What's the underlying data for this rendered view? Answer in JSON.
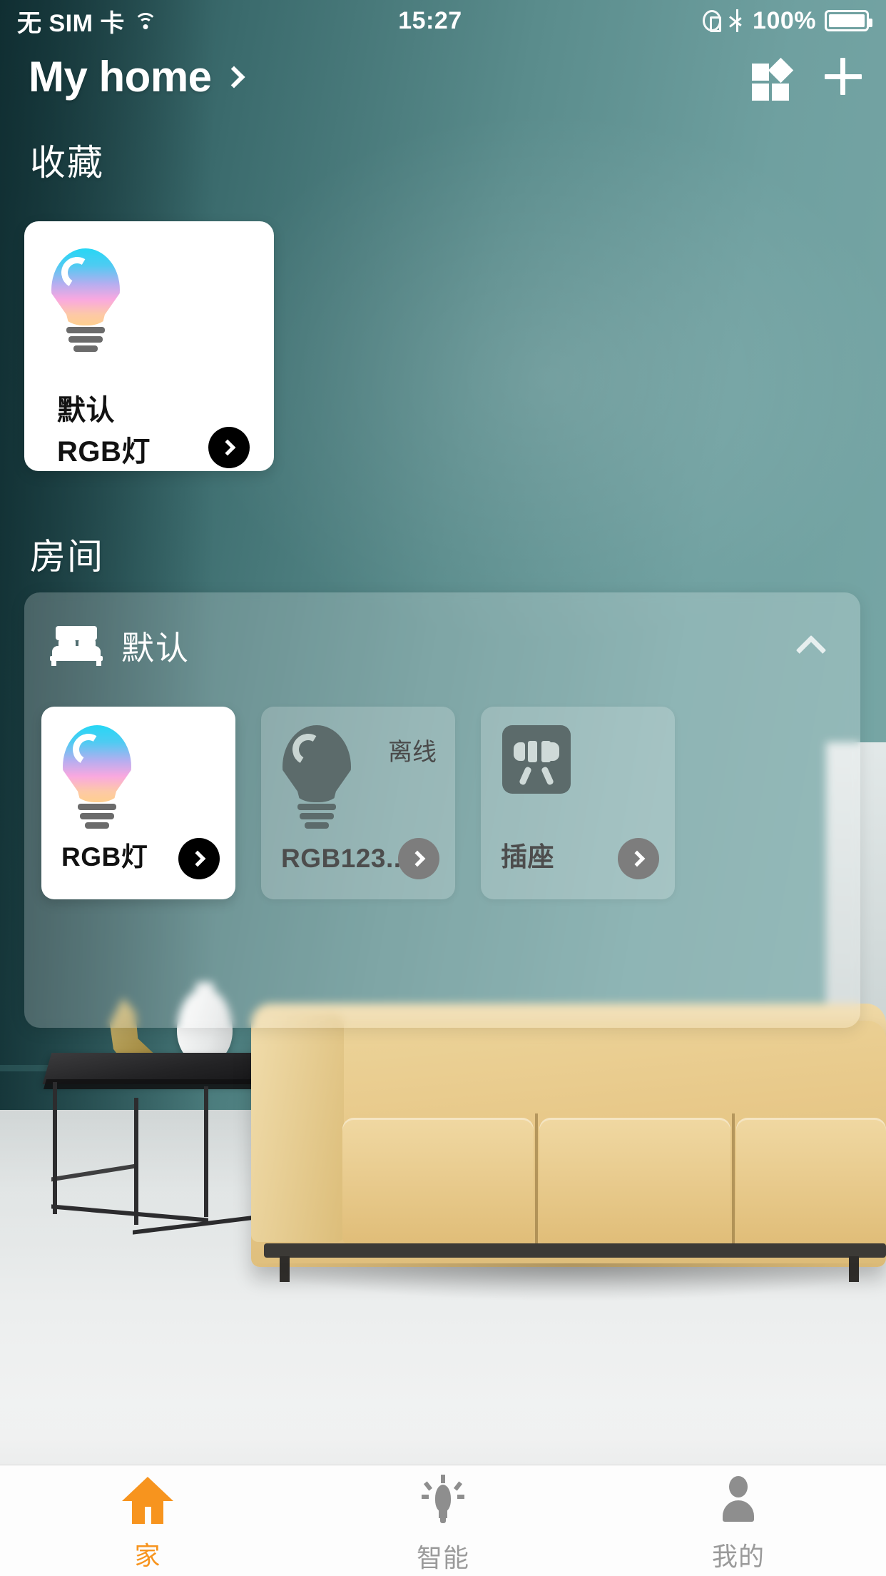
{
  "status_bar": {
    "carrier": "无 SIM 卡",
    "wifi_icon": "wifi-icon",
    "time": "15:27",
    "rotation_lock_icon": "rotation-lock-icon",
    "bluetooth_icon": "bluetooth-icon",
    "battery_percent": "100%",
    "battery_icon": "battery-full-icon"
  },
  "header": {
    "title": "My home",
    "title_chevron_icon": "chevron-right-icon",
    "scene_icon": "scene-grid-icon",
    "add_icon": "plus-icon"
  },
  "favorites": {
    "section_title": "收藏",
    "card": {
      "device_icon": "rgb-bulb-icon",
      "room_name": "默认",
      "device_name": "RGB灯",
      "arrow_icon": "chevron-right-circle-icon",
      "arrow_color": "#000000"
    }
  },
  "rooms": {
    "section_title": "房间",
    "list": [
      {
        "room_icon": "bed-icon",
        "name": "默认",
        "collapse_icon": "chevron-up-icon",
        "devices": [
          {
            "icon": "rgb-bulb-icon",
            "name": "RGB灯",
            "status": "",
            "state": "online",
            "arrow_icon": "chevron-right-circle-icon",
            "arrow_color": "#000000"
          },
          {
            "icon": "bulb-off-icon",
            "name": "RGB123...",
            "status": "离线",
            "state": "offline",
            "arrow_icon": "chevron-right-circle-icon",
            "arrow_color": "#7d7d7d"
          },
          {
            "icon": "socket-icon",
            "name": "插座",
            "status": "",
            "state": "offline",
            "arrow_icon": "chevron-right-circle-icon",
            "arrow_color": "#7d7d7d"
          }
        ]
      }
    ]
  },
  "tabbar": {
    "items": [
      {
        "icon": "house-icon",
        "label": "家",
        "active": true
      },
      {
        "icon": "bulb-rays-icon",
        "label": "智能",
        "active": false
      },
      {
        "icon": "person-icon",
        "label": "我的",
        "active": false
      }
    ],
    "active_color": "#f7941e",
    "inactive_color": "#9a9a9a"
  }
}
